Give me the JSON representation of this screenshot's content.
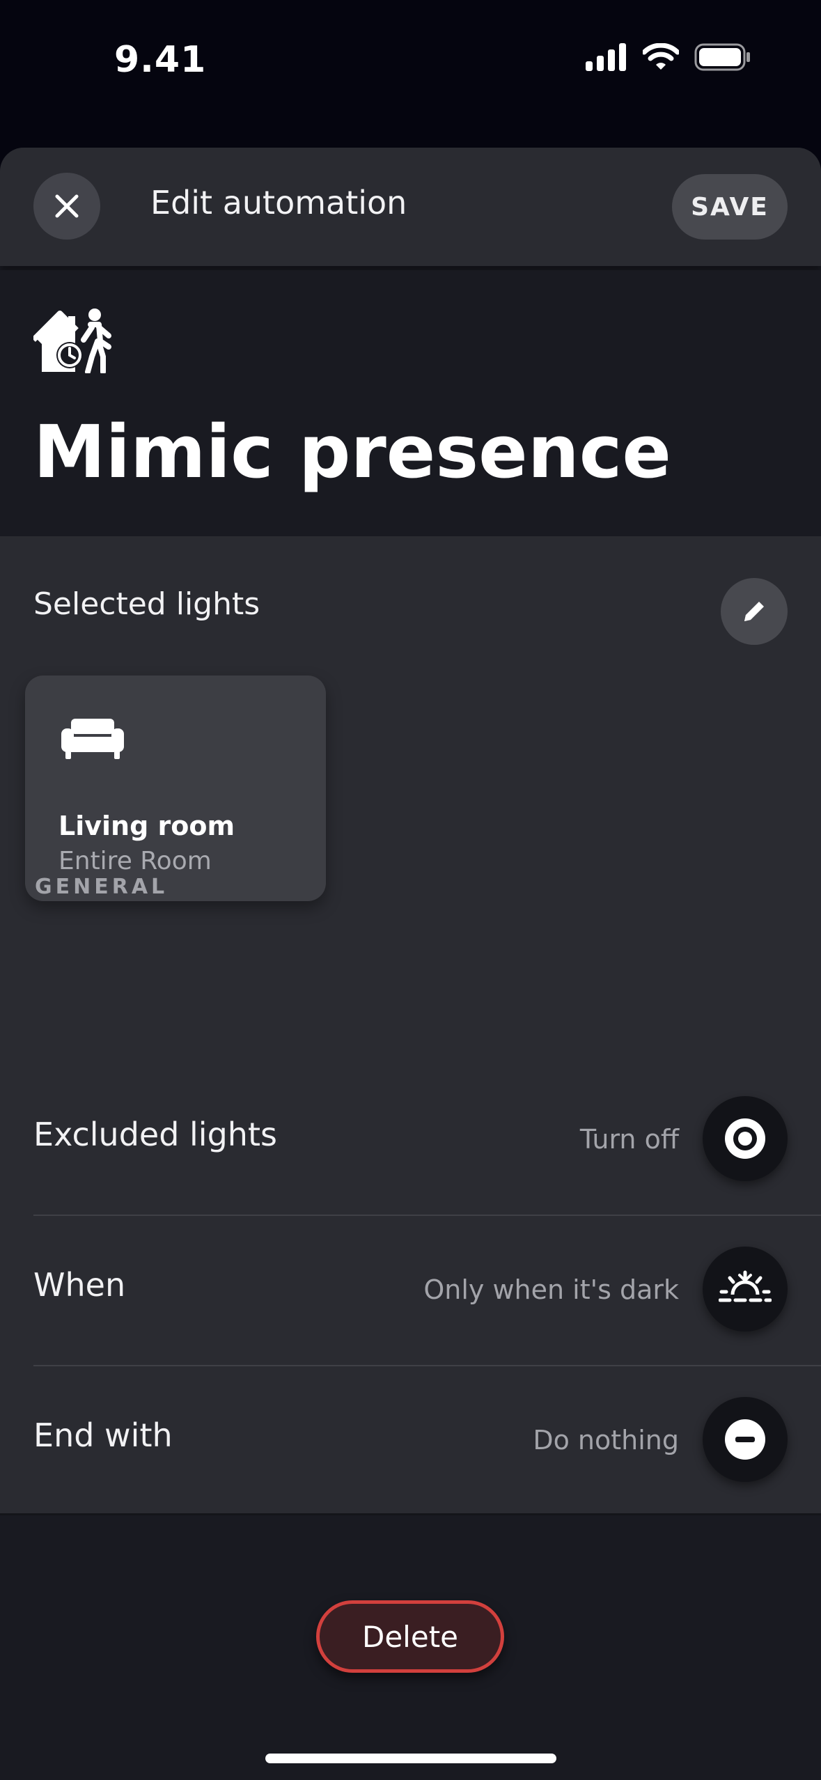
{
  "status_bar": {
    "time": "9.41"
  },
  "topbar": {
    "title": "Edit automation",
    "save_label": "SAVE"
  },
  "hero": {
    "title": "Mimic presence",
    "icon": "home-presence-icon"
  },
  "lights": {
    "label": "Selected lights",
    "rooms": [
      {
        "name": "Living room",
        "subtitle": "Entire Room",
        "icon": "sofa-icon"
      }
    ]
  },
  "general": {
    "label": "GENERAL",
    "rows": [
      {
        "label": "Excluded lights",
        "value": "Turn off",
        "icon": "target-icon"
      },
      {
        "label": "When",
        "value": "Only when it's dark",
        "icon": "sunset-icon"
      },
      {
        "label": "End with",
        "value": "Do nothing",
        "icon": "minus-circle-icon"
      }
    ]
  },
  "delete_label": "Delete",
  "colors": {
    "background": "#191a21",
    "surface": "#2a2b31",
    "danger": "#d2403d"
  }
}
